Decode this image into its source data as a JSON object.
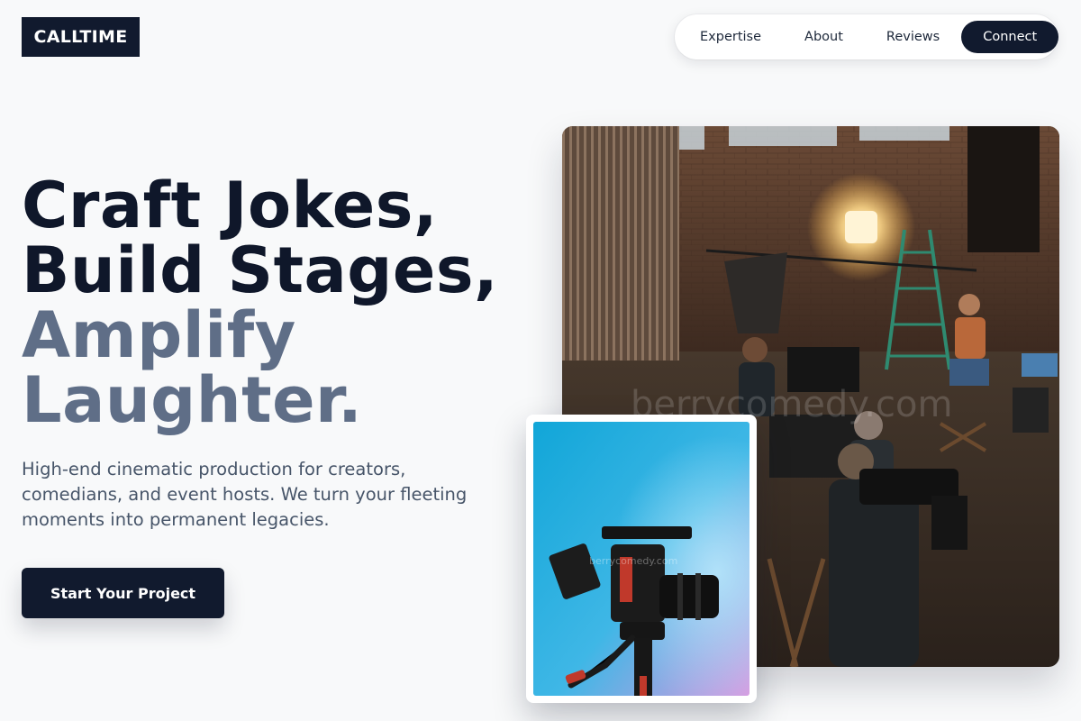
{
  "brand": {
    "logo_text": "CALLTIME"
  },
  "nav": {
    "items": [
      {
        "label": "Expertise"
      },
      {
        "label": "About"
      },
      {
        "label": "Reviews"
      }
    ],
    "cta_label": "Connect"
  },
  "hero": {
    "headline_line1": "Craft Jokes,",
    "headline_line2": "Build Stages,",
    "headline_line3": "Amplify",
    "headline_line4": "Laughter.",
    "subtitle": "High-end cinematic production for creators, comedians, and event hosts. We turn your fleeting moments into permanent legacies.",
    "cta_label": "Start Your Project"
  },
  "images": {
    "main": {
      "watermark": "berrycomedy.com"
    },
    "inset": {
      "watermark": "berrycomedy.com"
    }
  },
  "colors": {
    "primary": "#111a2e",
    "headline_dark": "#0f172a",
    "headline_muted": "#5f6e87",
    "body_text": "#475569",
    "background": "#f8f9fa"
  }
}
